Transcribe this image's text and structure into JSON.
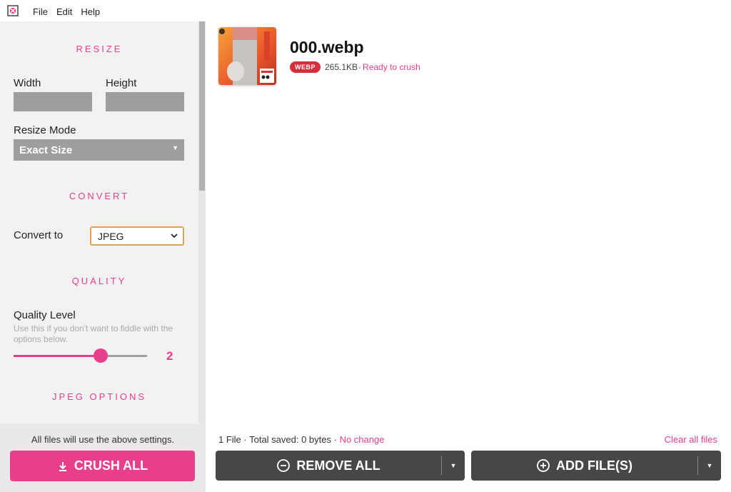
{
  "menu": {
    "file": "File",
    "edit": "Edit",
    "help": "Help"
  },
  "sidebar": {
    "resize": {
      "title": "RESIZE",
      "width_label": "Width",
      "height_label": "Height",
      "width_value": "",
      "height_value": "",
      "mode_label": "Resize Mode",
      "mode_value": "Exact Size"
    },
    "convert": {
      "title": "CONVERT",
      "label": "Convert to",
      "value": "JPEG"
    },
    "quality": {
      "title": "QUALITY",
      "label": "Quality Level",
      "hint": "Use this if you don't want to fiddle with the options below.",
      "value": "2",
      "fraction": 0.65
    },
    "jpeg_options": {
      "title": "JPEG OPTIONS"
    },
    "footer_note": "All files will use the above settings.",
    "crush_all": "CRUSH ALL"
  },
  "main": {
    "file": {
      "name": "000.webp",
      "badge": "WEBP",
      "size": "265.1KB",
      "separator": "·",
      "status": "Ready to crush"
    },
    "summary": {
      "text": "1 File · Total saved: 0 bytes ·",
      "change": "No change"
    },
    "clear_all": "Clear all files",
    "remove_all": "REMOVE ALL",
    "add_files": "ADD FILE(S)"
  },
  "colors": {
    "accent": "#e83e8c",
    "dark_button": "#474747",
    "badge": "#d62f3b"
  }
}
